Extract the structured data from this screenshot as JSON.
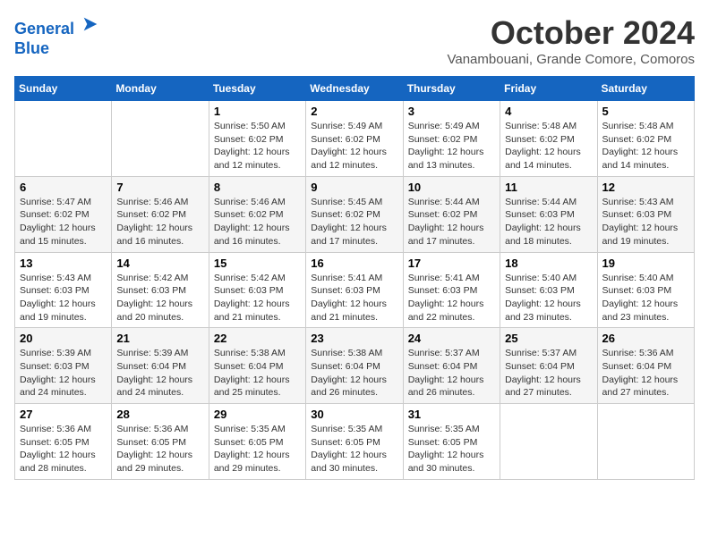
{
  "header": {
    "logo_line1": "General",
    "logo_line2": "Blue",
    "month": "October 2024",
    "location": "Vanambouani, Grande Comore, Comoros"
  },
  "days_of_week": [
    "Sunday",
    "Monday",
    "Tuesday",
    "Wednesday",
    "Thursday",
    "Friday",
    "Saturday"
  ],
  "weeks": [
    [
      {
        "day": "",
        "info": ""
      },
      {
        "day": "",
        "info": ""
      },
      {
        "day": "1",
        "info": "Sunrise: 5:50 AM\nSunset: 6:02 PM\nDaylight: 12 hours and 12 minutes."
      },
      {
        "day": "2",
        "info": "Sunrise: 5:49 AM\nSunset: 6:02 PM\nDaylight: 12 hours and 12 minutes."
      },
      {
        "day": "3",
        "info": "Sunrise: 5:49 AM\nSunset: 6:02 PM\nDaylight: 12 hours and 13 minutes."
      },
      {
        "day": "4",
        "info": "Sunrise: 5:48 AM\nSunset: 6:02 PM\nDaylight: 12 hours and 14 minutes."
      },
      {
        "day": "5",
        "info": "Sunrise: 5:48 AM\nSunset: 6:02 PM\nDaylight: 12 hours and 14 minutes."
      }
    ],
    [
      {
        "day": "6",
        "info": "Sunrise: 5:47 AM\nSunset: 6:02 PM\nDaylight: 12 hours and 15 minutes."
      },
      {
        "day": "7",
        "info": "Sunrise: 5:46 AM\nSunset: 6:02 PM\nDaylight: 12 hours and 16 minutes."
      },
      {
        "day": "8",
        "info": "Sunrise: 5:46 AM\nSunset: 6:02 PM\nDaylight: 12 hours and 16 minutes."
      },
      {
        "day": "9",
        "info": "Sunrise: 5:45 AM\nSunset: 6:02 PM\nDaylight: 12 hours and 17 minutes."
      },
      {
        "day": "10",
        "info": "Sunrise: 5:44 AM\nSunset: 6:02 PM\nDaylight: 12 hours and 17 minutes."
      },
      {
        "day": "11",
        "info": "Sunrise: 5:44 AM\nSunset: 6:03 PM\nDaylight: 12 hours and 18 minutes."
      },
      {
        "day": "12",
        "info": "Sunrise: 5:43 AM\nSunset: 6:03 PM\nDaylight: 12 hours and 19 minutes."
      }
    ],
    [
      {
        "day": "13",
        "info": "Sunrise: 5:43 AM\nSunset: 6:03 PM\nDaylight: 12 hours and 19 minutes."
      },
      {
        "day": "14",
        "info": "Sunrise: 5:42 AM\nSunset: 6:03 PM\nDaylight: 12 hours and 20 minutes."
      },
      {
        "day": "15",
        "info": "Sunrise: 5:42 AM\nSunset: 6:03 PM\nDaylight: 12 hours and 21 minutes."
      },
      {
        "day": "16",
        "info": "Sunrise: 5:41 AM\nSunset: 6:03 PM\nDaylight: 12 hours and 21 minutes."
      },
      {
        "day": "17",
        "info": "Sunrise: 5:41 AM\nSunset: 6:03 PM\nDaylight: 12 hours and 22 minutes."
      },
      {
        "day": "18",
        "info": "Sunrise: 5:40 AM\nSunset: 6:03 PM\nDaylight: 12 hours and 23 minutes."
      },
      {
        "day": "19",
        "info": "Sunrise: 5:40 AM\nSunset: 6:03 PM\nDaylight: 12 hours and 23 minutes."
      }
    ],
    [
      {
        "day": "20",
        "info": "Sunrise: 5:39 AM\nSunset: 6:03 PM\nDaylight: 12 hours and 24 minutes."
      },
      {
        "day": "21",
        "info": "Sunrise: 5:39 AM\nSunset: 6:04 PM\nDaylight: 12 hours and 24 minutes."
      },
      {
        "day": "22",
        "info": "Sunrise: 5:38 AM\nSunset: 6:04 PM\nDaylight: 12 hours and 25 minutes."
      },
      {
        "day": "23",
        "info": "Sunrise: 5:38 AM\nSunset: 6:04 PM\nDaylight: 12 hours and 26 minutes."
      },
      {
        "day": "24",
        "info": "Sunrise: 5:37 AM\nSunset: 6:04 PM\nDaylight: 12 hours and 26 minutes."
      },
      {
        "day": "25",
        "info": "Sunrise: 5:37 AM\nSunset: 6:04 PM\nDaylight: 12 hours and 27 minutes."
      },
      {
        "day": "26",
        "info": "Sunrise: 5:36 AM\nSunset: 6:04 PM\nDaylight: 12 hours and 27 minutes."
      }
    ],
    [
      {
        "day": "27",
        "info": "Sunrise: 5:36 AM\nSunset: 6:05 PM\nDaylight: 12 hours and 28 minutes."
      },
      {
        "day": "28",
        "info": "Sunrise: 5:36 AM\nSunset: 6:05 PM\nDaylight: 12 hours and 29 minutes."
      },
      {
        "day": "29",
        "info": "Sunrise: 5:35 AM\nSunset: 6:05 PM\nDaylight: 12 hours and 29 minutes."
      },
      {
        "day": "30",
        "info": "Sunrise: 5:35 AM\nSunset: 6:05 PM\nDaylight: 12 hours and 30 minutes."
      },
      {
        "day": "31",
        "info": "Sunrise: 5:35 AM\nSunset: 6:05 PM\nDaylight: 12 hours and 30 minutes."
      },
      {
        "day": "",
        "info": ""
      },
      {
        "day": "",
        "info": ""
      }
    ]
  ]
}
